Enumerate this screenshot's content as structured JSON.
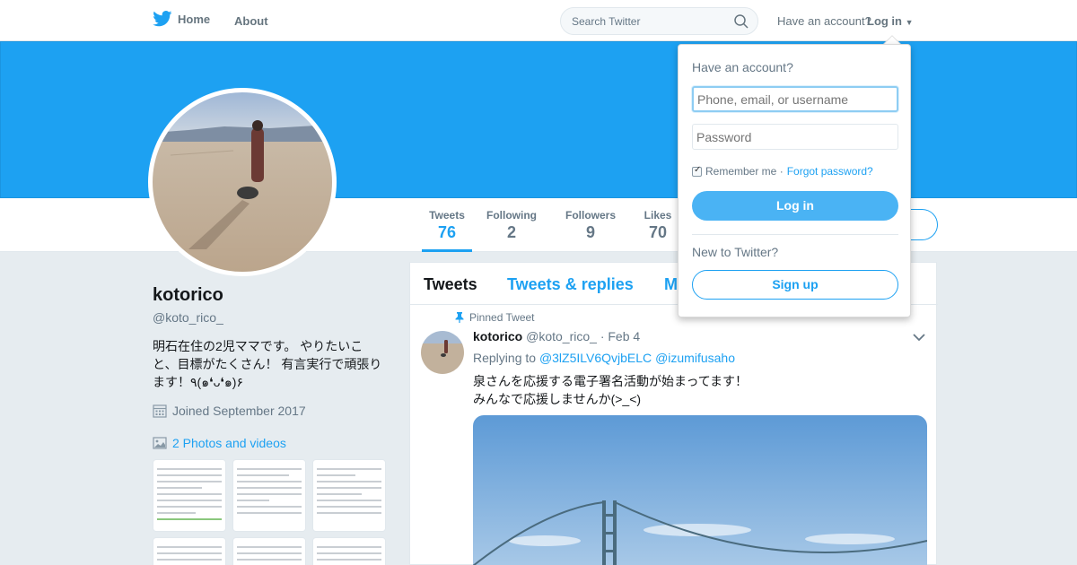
{
  "nav": {
    "home_label": "Home",
    "about_label": "About",
    "search_placeholder": "Search Twitter",
    "have_account": "Have an account?",
    "login_label": "Log in"
  },
  "profile": {
    "name": "kotorico",
    "handle": "@koto_rico_",
    "bio_line1": "明石在住の2児ママです。 やりたいこ",
    "bio_line2": "と、目標がたくさん！ 有言実行で頑張り",
    "bio_line3": "ます！٩(๑❛ᴗ❛๑)۶",
    "joined": "Joined September 2017",
    "photos": "2 Photos and videos"
  },
  "stats": [
    {
      "label": "Tweets",
      "value": "76"
    },
    {
      "label": "Following",
      "value": "2"
    },
    {
      "label": "Followers",
      "value": "9"
    },
    {
      "label": "Likes",
      "value": "70"
    }
  ],
  "timeline": {
    "tabs": [
      "Tweets",
      "Tweets & replies",
      "M"
    ],
    "pinned_label": "Pinned Tweet",
    "tweet": {
      "name": "kotorico",
      "handle": "@koto_rico_",
      "date": "· Feb 4",
      "replying_prefix": "Replying to",
      "reply_to_1": "@3lZ5ILV6QvjbELC",
      "reply_to_2": "@izumifusaho",
      "text_line1": "泉さんを応援する電子署名活動が始まってます！",
      "text_line2": "みんなで応援しませんか(>_<)"
    }
  },
  "login_dropdown": {
    "title": "Have an account?",
    "username_placeholder": "Phone, email, or username",
    "password_placeholder": "Password",
    "remember_label": "Remember me ·",
    "forgot_label": "Forgot password?",
    "remember_checked": true,
    "login_button": "Log in",
    "new_label": "New to Twitter?",
    "signup_button": "Sign up"
  },
  "colors": {
    "brand": "#1da1f2",
    "background": "#e6ecf0"
  }
}
